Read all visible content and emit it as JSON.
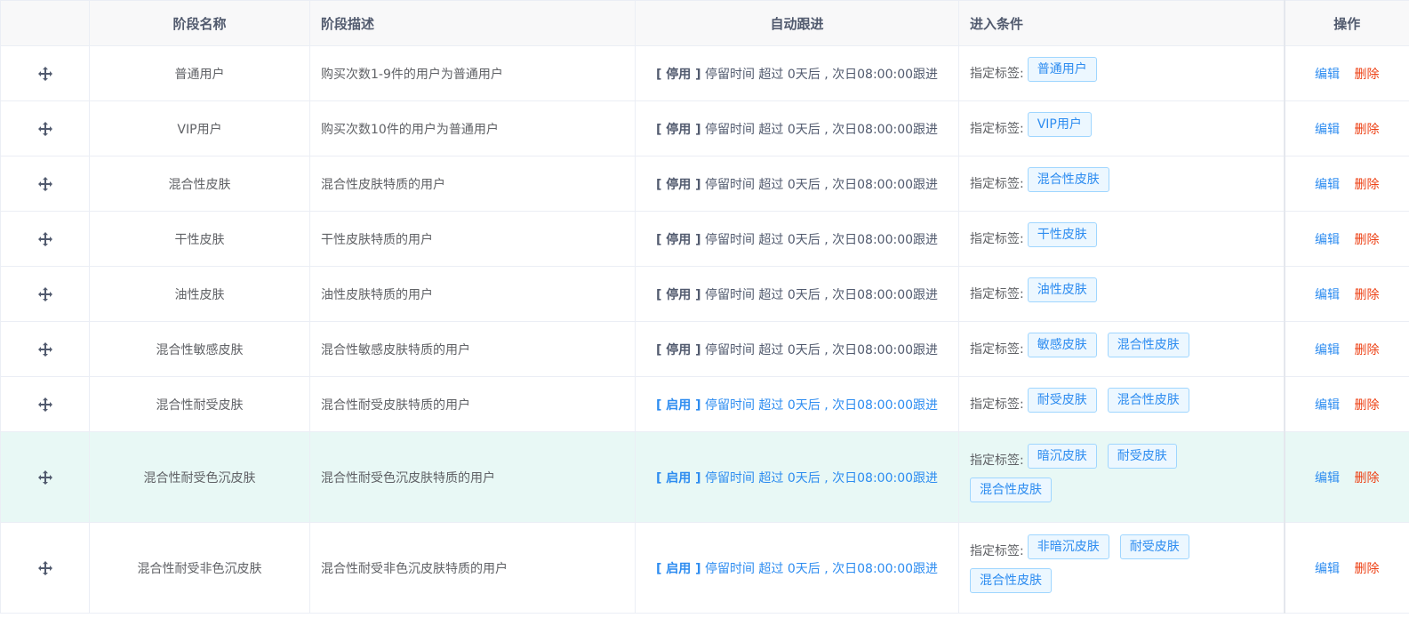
{
  "headers": {
    "name": "阶段名称",
    "desc": "阶段描述",
    "auto": "自动跟进",
    "cond": "进入条件",
    "ops": "操作"
  },
  "cond_label": "指定标签:",
  "actions": {
    "edit": "编辑",
    "delete": "删除"
  },
  "colors": {
    "accent": "#2d8cf0",
    "danger": "#ed4014",
    "row_highlight": "#e8f8f5"
  },
  "rows": [
    {
      "name": "普通用户",
      "desc": "购买次数1-9件的用户为普通用户",
      "status": "[ 停用 ]",
      "rule": "停留时间 超过 0天后 , 次日08:00:00跟进",
      "enabled": false,
      "tags": [
        "普通用户"
      ]
    },
    {
      "name": "VIP用户",
      "desc": "购买次数10件的用户为普通用户",
      "status": "[ 停用 ]",
      "rule": "停留时间 超过 0天后 , 次日08:00:00跟进",
      "enabled": false,
      "tags": [
        "VIP用户"
      ]
    },
    {
      "name": "混合性皮肤",
      "desc": "混合性皮肤特质的用户",
      "status": "[ 停用 ]",
      "rule": "停留时间 超过 0天后 , 次日08:00:00跟进",
      "enabled": false,
      "tags": [
        "混合性皮肤"
      ]
    },
    {
      "name": "干性皮肤",
      "desc": "干性皮肤特质的用户",
      "status": "[ 停用 ]",
      "rule": "停留时间 超过 0天后 , 次日08:00:00跟进",
      "enabled": false,
      "tags": [
        "干性皮肤"
      ]
    },
    {
      "name": "油性皮肤",
      "desc": "油性皮肤特质的用户",
      "status": "[ 停用 ]",
      "rule": "停留时间 超过 0天后 , 次日08:00:00跟进",
      "enabled": false,
      "tags": [
        "油性皮肤"
      ]
    },
    {
      "name": "混合性敏感皮肤",
      "desc": "混合性敏感皮肤特质的用户",
      "status": "[ 停用 ]",
      "rule": "停留时间 超过 0天后 , 次日08:00:00跟进",
      "enabled": false,
      "tags": [
        "敏感皮肤",
        "混合性皮肤"
      ]
    },
    {
      "name": "混合性耐受皮肤",
      "desc": "混合性耐受皮肤特质的用户",
      "status": "[ 启用 ]",
      "rule": "停留时间 超过 0天后 , 次日08:00:00跟进",
      "enabled": true,
      "tags": [
        "耐受皮肤",
        "混合性皮肤"
      ]
    },
    {
      "name": "混合性耐受色沉皮肤",
      "desc": "混合性耐受色沉皮肤特质的用户",
      "status": "[ 启用 ]",
      "rule": "停留时间 超过 0天后 , 次日08:00:00跟进",
      "enabled": true,
      "tags": [
        "暗沉皮肤",
        "耐受皮肤",
        "混合性皮肤"
      ]
    },
    {
      "name": "混合性耐受非色沉皮肤",
      "desc": "混合性耐受非色沉皮肤特质的用户",
      "status": "[ 启用 ]",
      "rule": "停留时间 超过 0天后 , 次日08:00:00跟进",
      "enabled": true,
      "tags": [
        "非暗沉皮肤",
        "耐受皮肤",
        "混合性皮肤"
      ]
    }
  ]
}
